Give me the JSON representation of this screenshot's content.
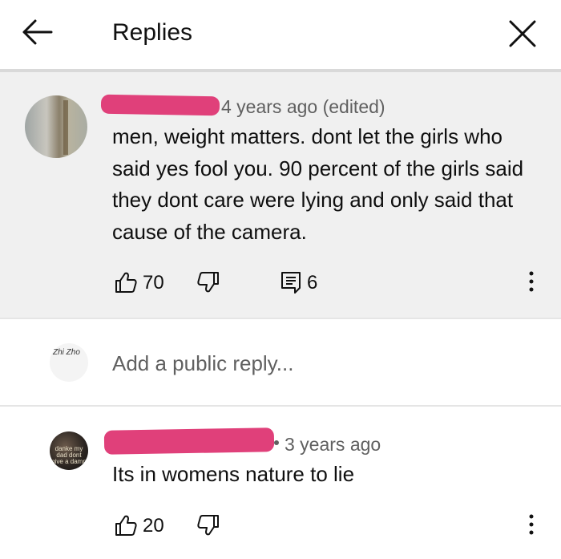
{
  "header": {
    "title": "Replies",
    "back_icon": "arrow-left-icon",
    "close_icon": "close-icon"
  },
  "parent_comment": {
    "time": "4 years ago (edited)",
    "text": "men, weight matters. dont let the girls who said yes fool you. 90 percent of the girls said they dont care were lying and only said that cause of the camera.",
    "likes": "70",
    "replies": "6"
  },
  "reply_box": {
    "placeholder": "Add a public reply...",
    "avatar_text": "Zhi Zho"
  },
  "reply_comment": {
    "time": "3 years ago",
    "text": "Its in womens nature to lie",
    "likes": "20",
    "avatar_text": "danke my dad dont give a damn"
  },
  "colors": {
    "redaction": "#e0407a",
    "parent_bg": "#f0f0f0",
    "meta_text": "#606060"
  }
}
